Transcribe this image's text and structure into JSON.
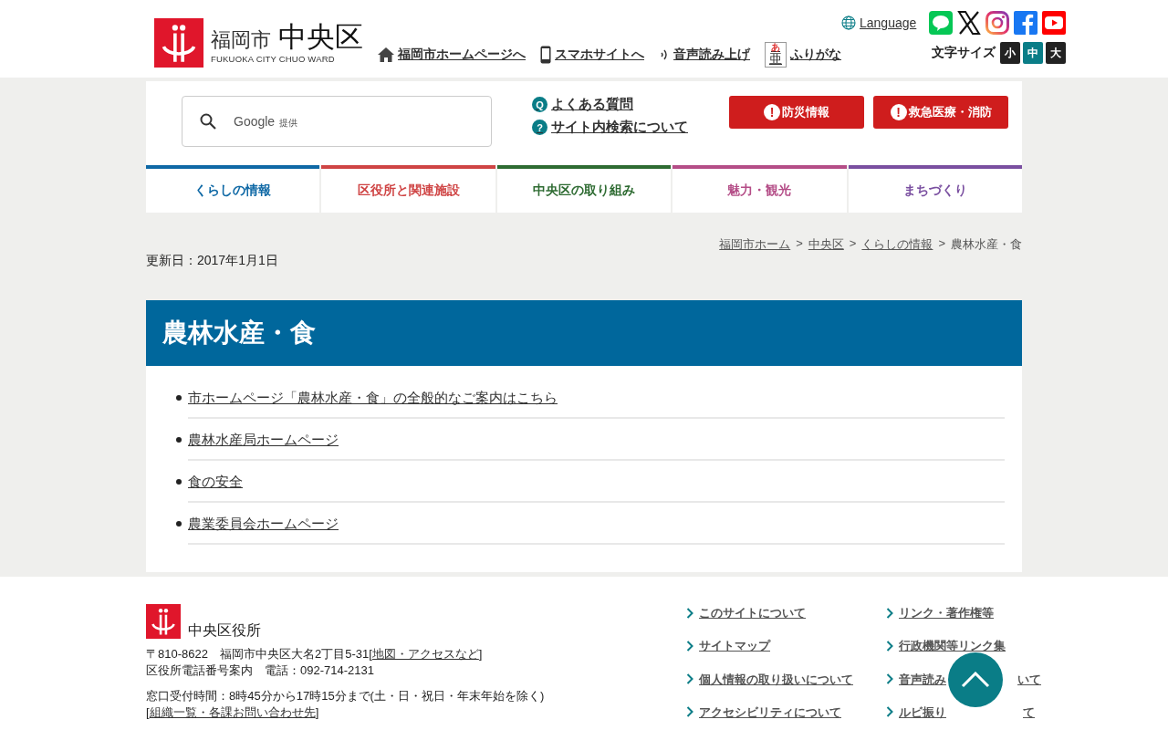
{
  "header": {
    "logo_city": "福岡市",
    "logo_ward": "中央区",
    "logo_sub": "FUKUOKA CITY CHUO WARD",
    "language": "Language",
    "links": [
      {
        "kind": "home",
        "label": "福岡市ホームページへ"
      },
      {
        "kind": "phone",
        "label": "スマホサイトへ"
      },
      {
        "kind": "voice",
        "label": "音声読み上げ"
      },
      {
        "kind": "ruby",
        "label": "ふりがな",
        "icon_top": "あ",
        "icon_main": "亜"
      }
    ],
    "social": [
      {
        "kind": "line"
      },
      {
        "kind": "x"
      },
      {
        "kind": "instagram"
      },
      {
        "kind": "facebook"
      },
      {
        "kind": "youtube"
      }
    ],
    "font_size_label": "文字サイズ",
    "font_sizes": [
      {
        "label": "小",
        "selected": false
      },
      {
        "label": "中",
        "selected": true
      },
      {
        "label": "大",
        "selected": false
      }
    ]
  },
  "search": {
    "placeholder": "Google",
    "placeholder_sub": "提供"
  },
  "help_links": [
    {
      "icon": "Q",
      "label": "よくある質問"
    },
    {
      "icon": "?",
      "label": "サイト内検索について"
    }
  ],
  "alerts": [
    {
      "icon": "!",
      "label": "防災情報"
    },
    {
      "icon": "!",
      "label": "救急医療・消防"
    }
  ],
  "nav": [
    {
      "label": "くらしの情報",
      "color": "#0e68a5"
    },
    {
      "label": "区役所と関連施設",
      "color": "#cf4444"
    },
    {
      "label": "中央区の取り組み",
      "color": "#2e6b32"
    },
    {
      "label": "魅力・観光",
      "color": "#b44d87"
    },
    {
      "label": "まちづくり",
      "color": "#7a4fa0"
    }
  ],
  "breadcrumb": [
    {
      "label": "福岡市ホーム",
      "link": true
    },
    {
      "label": "中央区",
      "link": true
    },
    {
      "label": "くらしの情報",
      "link": true
    },
    {
      "label": "農林水産・食",
      "link": false
    }
  ],
  "breadcrumb_separator": ">",
  "updated": "更新日：2017年1月1日",
  "title": "農林水産・食",
  "items": [
    "市ホームページ「農林水産・食」の全般的なご案内はこちら",
    "農林水産局ホームページ",
    "食の安全",
    "農業委員会ホームページ"
  ],
  "footer": {
    "office": "中央区役所",
    "address": "〒810-8622　福岡市中央区大名2丁目5-31 ",
    "bracket_open": "[",
    "bracket_close": "]",
    "address_link": "地図・アクセスなど",
    "phone": "区役所電話番号案内　電話：092-714-2131",
    "hours": "窓口受付時間：8時45分から17時15分まで(土・日・祝日・年末年始を除く)",
    "org_link": "組織一覧・各課お問い合わせ先",
    "links": [
      {
        "label": "このサイトについて"
      },
      {
        "label": "リンク・著作権等"
      },
      {
        "label": "サイトマップ"
      },
      {
        "label": "行政機関等リンク集"
      },
      {
        "label": "個人情報の取り扱いについて"
      },
      {
        "label": "音声読み",
        "label_after_cover": "いて"
      },
      {
        "label": "アクセシビリティについて"
      },
      {
        "label": "ルビ振り",
        "label_after_cover": "て"
      }
    ]
  }
}
